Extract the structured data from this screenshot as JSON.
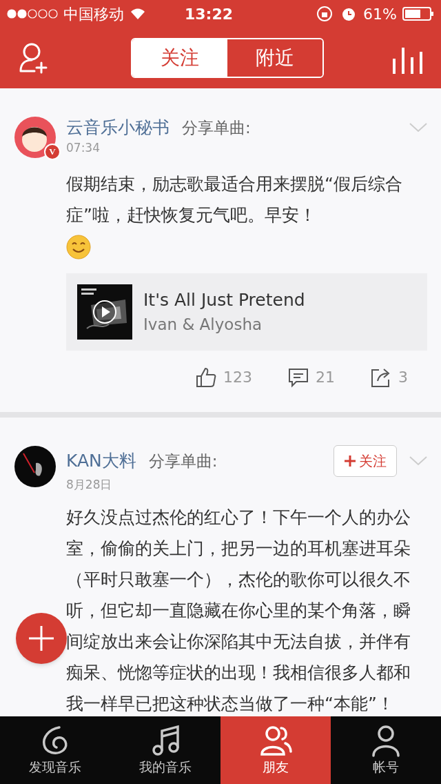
{
  "status_bar": {
    "carrier": "中国移动",
    "time": "13:22",
    "battery": "61%"
  },
  "nav": {
    "tabs": [
      {
        "label": "关注",
        "selected": true
      },
      {
        "label": "附近",
        "selected": false
      }
    ]
  },
  "posts": [
    {
      "author": "云音乐小秘书",
      "action": "分享单曲:",
      "time": "07:34",
      "verified_badge": "V",
      "kind": "official",
      "text": "假期结束，励志歌最适合用来摆脱“假后综合症”啦，赶快恢复元气吧。早安！",
      "emoji": true,
      "song": {
        "title": "It's All Just Pretend",
        "artist": "Ivan & Alyosha"
      },
      "stats": {
        "likes": "123",
        "comments": "21",
        "shares": "3"
      }
    },
    {
      "author": "KAN大料",
      "action": "分享单曲:",
      "time": "8月28日",
      "kind": "user",
      "follow_button": "关注",
      "text": "好久没点过杰伦的红心了！下午一个人的办公室，偷偷的关上门，把另一边的耳机塞进耳朵（平时只敢塞一个），杰伦的歌你可以很久不听，但它却一直隐藏在你心里的某个角落，瞬间绽放出来会让你深陷其中无法自拔，并伴有痴呆、恍惚等症状的出现！我相信很多人都和我一样早已把这种状态当做了一种“本能”！"
    }
  ],
  "tab_bar": [
    {
      "label": "发现音乐",
      "kind": "discover",
      "selected": false
    },
    {
      "label": "我的音乐",
      "kind": "music",
      "selected": false
    },
    {
      "label": "朋友",
      "kind": "friends",
      "selected": true
    },
    {
      "label": "帐号",
      "kind": "account",
      "selected": false
    }
  ]
}
